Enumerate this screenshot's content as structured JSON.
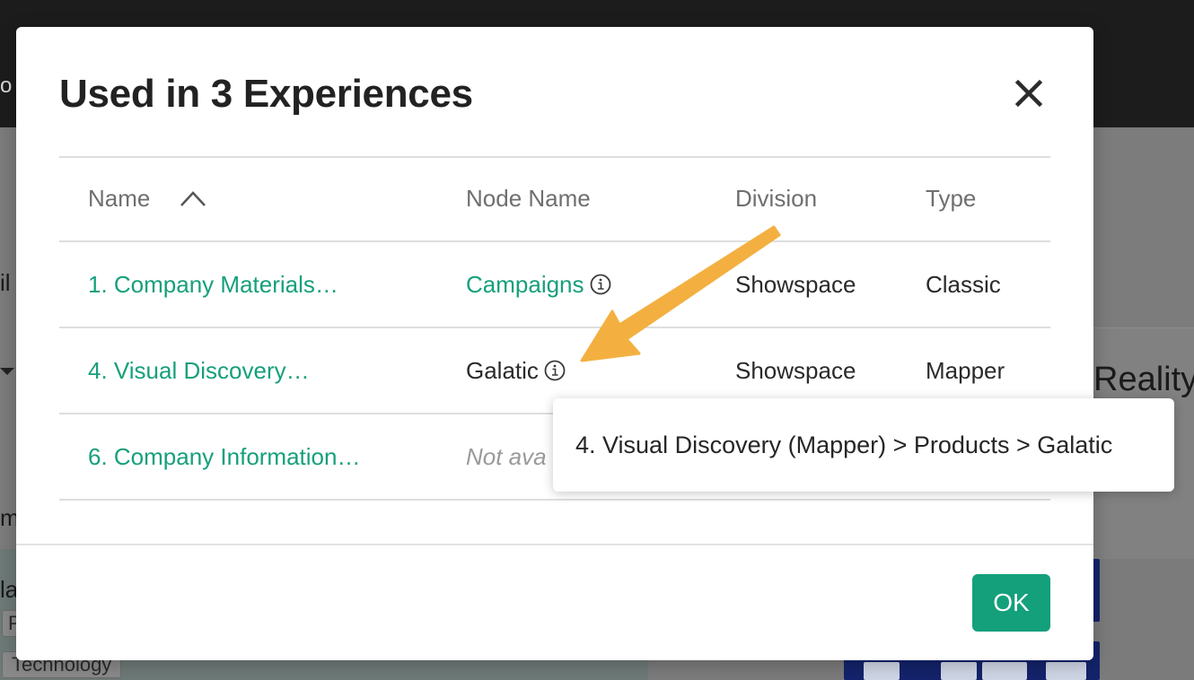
{
  "background": {
    "topbar_fragment": "o",
    "left_fragment_1": "il",
    "left_fragment_2": "m",
    "left_fragment_3": "la",
    "tag_fragment": "P",
    "tag_label": "Technology",
    "right_fragment": "Reality"
  },
  "modal": {
    "title": "Used in 3 Experiences",
    "close_icon": "close-icon",
    "ok_label": "OK"
  },
  "table": {
    "headers": {
      "name": "Name",
      "node_name": "Node Name",
      "division": "Division",
      "type": "Type"
    },
    "sort_icon": "chevron-up-icon",
    "rows": [
      {
        "name": "1. Company Materials…",
        "node_name": "Campaigns",
        "division": "Showspace",
        "type": "Classic"
      },
      {
        "name": "4. Visual Discovery…",
        "node_name": "Galatic",
        "division": "Showspace",
        "type": "Mapper"
      },
      {
        "name": "6. Company Information…",
        "node_name": "Not ava",
        "division": "",
        "type": ""
      }
    ]
  },
  "tooltip": {
    "text": "4. Visual Discovery (Mapper) > Products > Galatic"
  },
  "colors": {
    "link": "#16a07b",
    "ok_button": "#13a07b",
    "annotation_arrow": "#f3b041"
  }
}
